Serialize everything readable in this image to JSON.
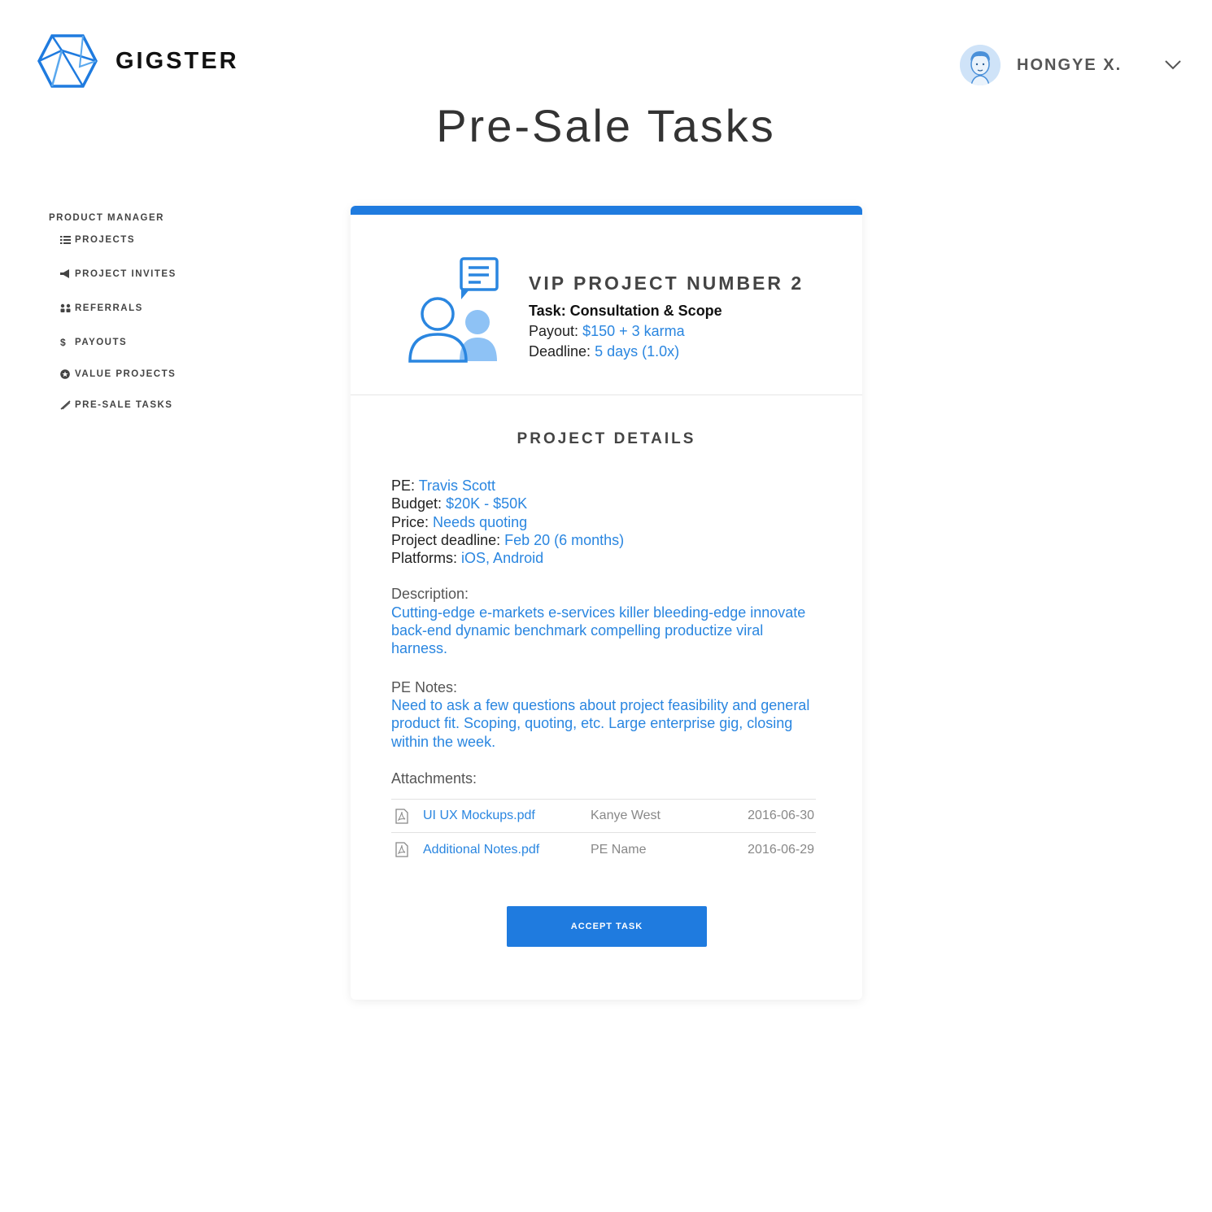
{
  "brand": {
    "name": "GIGSTER"
  },
  "user": {
    "name": "HONGYE X."
  },
  "page": {
    "title": "Pre-Sale Tasks"
  },
  "sidebar": {
    "heading": "PRODUCT MANAGER",
    "items": [
      {
        "label": "PROJECTS",
        "icon": "list-icon"
      },
      {
        "label": "PROJECT INVITES",
        "icon": "megaphone-icon"
      },
      {
        "label": "REFERRALS",
        "icon": "people-icon"
      },
      {
        "label": "PAYOUTS",
        "icon": "dollar-icon"
      },
      {
        "label": "VALUE PROJECTS",
        "icon": "star-circle-icon"
      },
      {
        "label": "PRE-SALE TASKS",
        "icon": "pen-icon"
      }
    ]
  },
  "task": {
    "project_name": "VIP PROJECT NUMBER 2",
    "task_line": "Task: Consultation & Scope",
    "payout_label": "Payout:",
    "payout_value": "$150 + 3 karma",
    "deadline_label": "Deadline:",
    "deadline_value": "5 days (1.0x)"
  },
  "details": {
    "title": "PROJECT DETAILS",
    "pe_label": "PE:",
    "pe_value": "Travis Scott",
    "budget_label": "Budget:",
    "budget_value": "$20K - $50K",
    "price_label": "Price:",
    "price_value": "Needs quoting",
    "project_deadline_label": "Project deadline:",
    "project_deadline_value": "Feb 20 (6 months)",
    "platforms_label": "Platforms:",
    "platforms_value": "iOS, Android",
    "description_label": "Description:",
    "description_text": "Cutting-edge e-markets e-services killer bleeding-edge innovate back-end dynamic benchmark compelling productize viral harness.",
    "notes_label": "PE Notes:",
    "notes_text": "Need to ask a few questions about project feasibility and general product fit. Scoping, quoting, etc. Large enterprise gig, closing within the week."
  },
  "attachments": {
    "label": "Attachments:",
    "rows": [
      {
        "file": "UI UX Mockups.pdf",
        "owner": "Kanye West",
        "date": "2016-06-30",
        "icon": "pdf-icon"
      },
      {
        "file": "Additional Notes.pdf",
        "owner": "PE Name",
        "date": "2016-06-29",
        "icon": "pdf-icon"
      }
    ]
  },
  "actions": {
    "accept_label": "ACCEPT TASK"
  },
  "colors": {
    "accent": "#1f7bdf",
    "link": "#2a86e0",
    "text": "#222222",
    "muted": "#888888"
  }
}
